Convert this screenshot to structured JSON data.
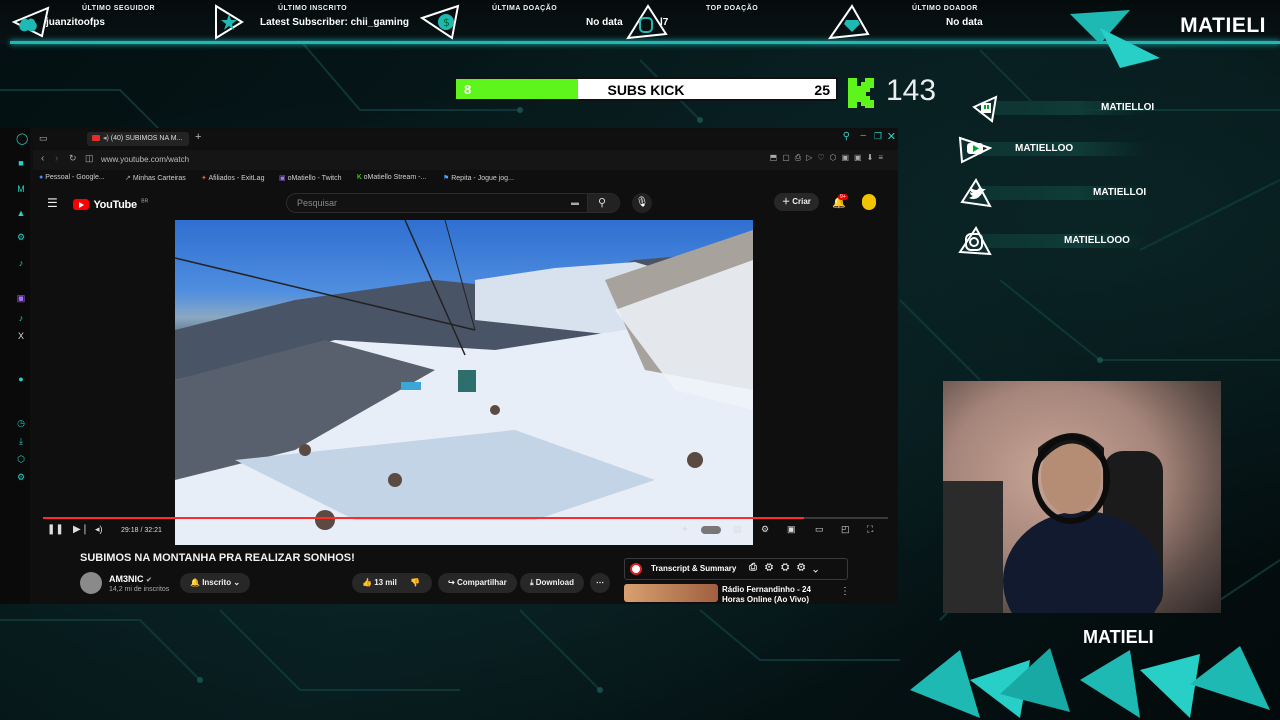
{
  "overlay": {
    "brand": "MATIELI",
    "colors": {
      "accent": "#1fb9b4",
      "kick_green": "#5ef51c"
    },
    "top_slots": [
      {
        "caption": "ÚLTIMO SEGUIDOR",
        "value": "juanzitoofps",
        "icon": "heart-icon"
      },
      {
        "caption": "ÚLTIMO INSCRITO",
        "value": "Latest Subscriber: chii_gaming",
        "icon": "star-icon"
      },
      {
        "caption": "ÚLTIMA DOAÇÃO",
        "value": "No data",
        "icon": "dollar-icon"
      },
      {
        "caption": "TOP DOAÇÃO",
        "value": "l7",
        "icon": "money-bag-icon"
      },
      {
        "caption": "ÚLTIMO DOADOR",
        "value": "No data",
        "icon": "diamond-icon"
      }
    ],
    "subs_kick": {
      "current": "8",
      "title": "SUBS KICK",
      "goal": "25",
      "progress": 0.32,
      "count": "143"
    },
    "socials": [
      {
        "icon": "twitch-icon",
        "name": "MATIELLOI"
      },
      {
        "icon": "youtube-icon",
        "name": "MATIELLOO"
      },
      {
        "icon": "twitter-icon",
        "name": "MATIELLOI"
      },
      {
        "icon": "instagram-icon",
        "name": "MATIELLOOO"
      }
    ],
    "brand_bottom": "MATIELI"
  },
  "browser": {
    "tab_label": "(40) SUBIMOS NA M...",
    "url": "www.youtube.com/watch",
    "bookmarks": [
      "Pessoal - Google...",
      "Minhas Carteiras",
      "Afiliados - ExitLag",
      "oMatiello - Twitch",
      "oMatiello Stream -...",
      "Repita - Jogue jog..."
    ]
  },
  "youtube": {
    "logo_text": "YouTube",
    "logo_region": "BR",
    "search_placeholder": "Pesquisar",
    "create_label": "Criar",
    "notif_badge": "9+",
    "time": "29:18 / 32:21",
    "progress": 0.9,
    "title": "SUBIMOS NA MONTANHA PRA REALIZAR SONHOS!",
    "channel": "AM3NIC",
    "subscribers": "14,2 mi de inscritos",
    "subscribed_label": "Inscrito",
    "likes": "13 mil",
    "share_label": "Compartilhar",
    "download_label": "Download",
    "transcript_label": "Transcript & Summary",
    "recommended_title": "Rádio Fernandinho - 24 Horas Online (Ao Vivo)"
  }
}
